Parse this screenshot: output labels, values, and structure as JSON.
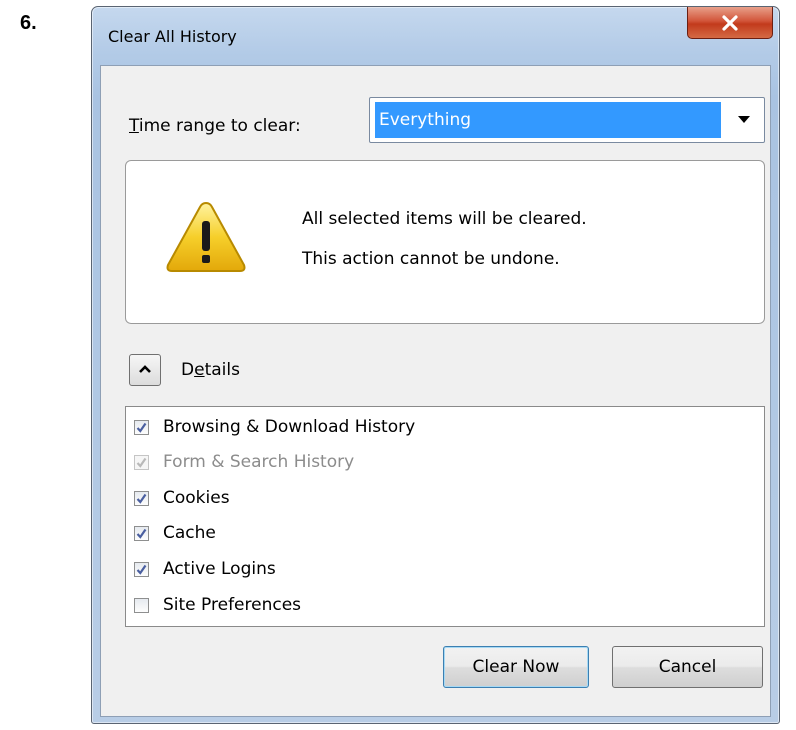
{
  "step": {
    "label": "6."
  },
  "window": {
    "title": "Clear All History",
    "close_icon": "close-x-icon"
  },
  "time_range": {
    "label_mnemonic": "T",
    "label_rest": "ime range to clear:",
    "selected_value": "Everything"
  },
  "warning": {
    "icon": "warning-triangle-icon",
    "line1": "All selected items will be cleared.",
    "line2": "This action cannot be undone."
  },
  "details": {
    "label_prefix": "D",
    "label_mnemonic": "e",
    "label_rest": "tails",
    "expanded": true,
    "toggle_icon": "chevron-up-icon"
  },
  "items": [
    {
      "label": "Browsing & Download History",
      "checked": true,
      "disabled": false
    },
    {
      "label": "Form & Search History",
      "checked": true,
      "disabled": true
    },
    {
      "label": "Cookies",
      "checked": true,
      "disabled": false
    },
    {
      "label": "Cache",
      "checked": true,
      "disabled": false
    },
    {
      "label": "Active Logins",
      "checked": true,
      "disabled": false
    },
    {
      "label": "Site Preferences",
      "checked": false,
      "disabled": false
    }
  ],
  "buttons": {
    "clear_now": "Clear Now",
    "cancel": "Cancel"
  },
  "colors": {
    "selection": "#3399ff",
    "checkmark": "#4a5fa0",
    "close_button": "#c7432a",
    "warning_yellow": "#f4c20d"
  }
}
